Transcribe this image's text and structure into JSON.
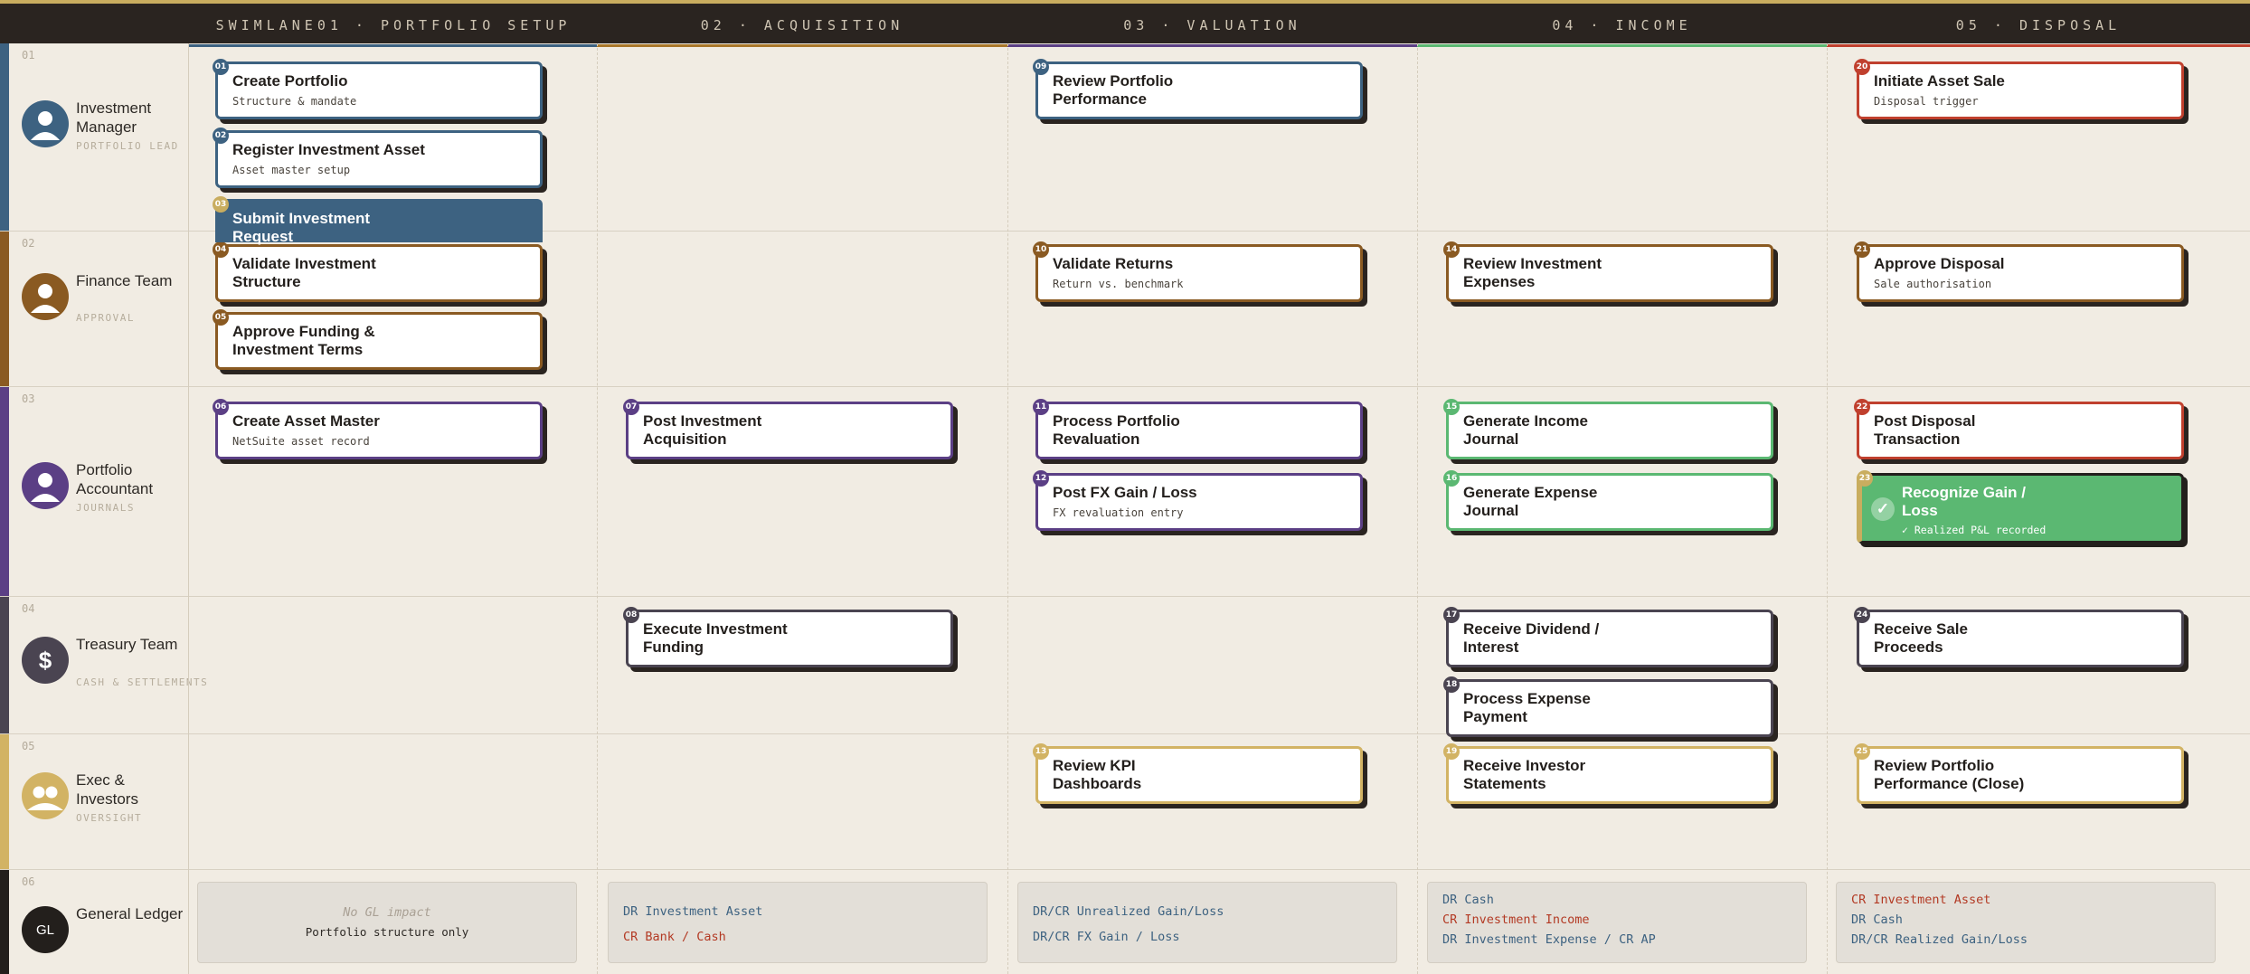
{
  "header": {
    "lane_col_label": "SWIMLANE",
    "phases": [
      {
        "label": "01 · PORTFOLIO SETUP",
        "color": "#3d6281"
      },
      {
        "label": "02 · ACQUISITION",
        "color": "#a9772a"
      },
      {
        "label": "03 · VALUATION",
        "color": "#5b3f85"
      },
      {
        "label": "04 · INCOME",
        "color": "#5bb872"
      },
      {
        "label": "05 · DISPOSAL",
        "color": "#c0402e"
      }
    ]
  },
  "lanes": [
    {
      "num": "01",
      "name": "Investment Manager",
      "sub": "PORTFOLIO LEAD",
      "color": "#3d6281",
      "icon": "person-icon"
    },
    {
      "num": "02",
      "name": "Finance Team",
      "sub": "APPROVAL",
      "color": "#8a5a22",
      "icon": "person-icon"
    },
    {
      "num": "03",
      "name": "Portfolio Accountant",
      "sub": "JOURNALS",
      "color": "#5b3f85",
      "icon": "person-icon"
    },
    {
      "num": "04",
      "name": "Treasury Team",
      "sub": "CASH & SETTLEMENTS",
      "color": "#4a4451",
      "icon": "dollar-icon",
      "icon_glyph": "$"
    },
    {
      "num": "05",
      "name": "Exec & Investors",
      "sub": "OVERSIGHT",
      "color": "#d2b364",
      "icon": "group-icon"
    },
    {
      "num": "06",
      "name": "General Ledger",
      "sub": "",
      "color": "#231f1c",
      "icon": "gl-icon",
      "icon_glyph": "GL"
    }
  ],
  "tasks": [
    {
      "id": "01",
      "title": "Create Portfolio",
      "sub": "Structure & mandate",
      "color": "#3d6281"
    },
    {
      "id": "02",
      "title": "Register Investment Asset",
      "sub": "Asset master setup",
      "color": "#3d6281"
    },
    {
      "id": "03",
      "title": "Submit Investment Request",
      "sub": "",
      "color": "#3d6281"
    },
    {
      "id": "04",
      "title": "Validate Investment Structure",
      "sub": "",
      "color": "#8a5a22"
    },
    {
      "id": "05",
      "title": "Approve Funding & Investment Terms",
      "sub": "",
      "color": "#8a5a22"
    },
    {
      "id": "06",
      "title": "Create Asset Master",
      "sub": "NetSuite asset record",
      "color": "#5b3f85"
    },
    {
      "id": "07",
      "title": "Post Investment Acquisition",
      "sub": "",
      "color": "#5b3f85"
    },
    {
      "id": "08",
      "title": "Execute Investment Funding",
      "sub": "",
      "color": "#4a4451"
    },
    {
      "id": "09",
      "title": "Review Portfolio Performance",
      "sub": "",
      "color": "#3d6281"
    },
    {
      "id": "10",
      "title": "Validate Returns",
      "sub": "Return vs. benchmark",
      "color": "#8a5a22"
    },
    {
      "id": "11",
      "title": "Process Portfolio Revaluation",
      "sub": "",
      "color": "#5b3f85"
    },
    {
      "id": "12",
      "title": "Post FX Gain / Loss",
      "sub": "FX revaluation entry",
      "color": "#5b3f85"
    },
    {
      "id": "13",
      "title": "Review KPI Dashboards",
      "sub": "",
      "color": "#d2b364"
    },
    {
      "id": "14",
      "title": "Review Investment Expenses",
      "sub": "",
      "color": "#8a5a22"
    },
    {
      "id": "15",
      "title": "Generate Income Journal",
      "sub": "",
      "color": "#5bb872"
    },
    {
      "id": "16",
      "title": "Generate Expense Journal",
      "sub": "",
      "color": "#5bb872"
    },
    {
      "id": "17",
      "title": "Receive Dividend / Interest",
      "sub": "",
      "color": "#4a4451"
    },
    {
      "id": "18",
      "title": "Process Expense Payment",
      "sub": "",
      "color": "#4a4451"
    },
    {
      "id": "19",
      "title": "Receive Investor Statements",
      "sub": "",
      "color": "#d2b364"
    },
    {
      "id": "20",
      "title": "Initiate Asset Sale",
      "sub": "Disposal trigger",
      "color": "#c0402e"
    },
    {
      "id": "21",
      "title": "Approve Disposal",
      "sub": "Sale authorisation",
      "color": "#8a5a22"
    },
    {
      "id": "22",
      "title": "Post Disposal Transaction",
      "sub": "",
      "color": "#c0402e"
    },
    {
      "id": "23",
      "title": "Recognize Gain / Loss",
      "sub": "✓ Realized P&L recorded",
      "color": "#5bb872"
    },
    {
      "id": "24",
      "title": "Receive Sale Proceeds",
      "sub": "",
      "color": "#4a4451"
    },
    {
      "id": "25",
      "title": "Review Portfolio Performance (Close)",
      "sub": "",
      "color": "#d2b364"
    }
  ],
  "gl": [
    {
      "note": "No GL impact",
      "desc": "Portfolio structure only",
      "lines": []
    },
    {
      "lines": [
        {
          "text": "DR Investment Asset",
          "kind": "dr"
        },
        {
          "text": "CR Bank / Cash",
          "kind": "cr"
        }
      ]
    },
    {
      "lines": [
        {
          "text": "DR/CR Unrealized Gain/Loss",
          "kind": "dc"
        },
        {
          "text": "DR/CR FX Gain / Loss",
          "kind": "dc"
        }
      ]
    },
    {
      "lines": [
        {
          "text": "DR Cash",
          "kind": "dr"
        },
        {
          "text": "CR Investment Income",
          "kind": "cr"
        },
        {
          "text": "DR Investment Expense / CR AP",
          "kind": "dc"
        }
      ]
    },
    {
      "lines": [
        {
          "text": "CR Investment Asset",
          "kind": "cr"
        },
        {
          "text": "DR Cash",
          "kind": "dr"
        },
        {
          "text": "DR/CR Realized Gain/Loss",
          "kind": "dc"
        }
      ]
    }
  ]
}
